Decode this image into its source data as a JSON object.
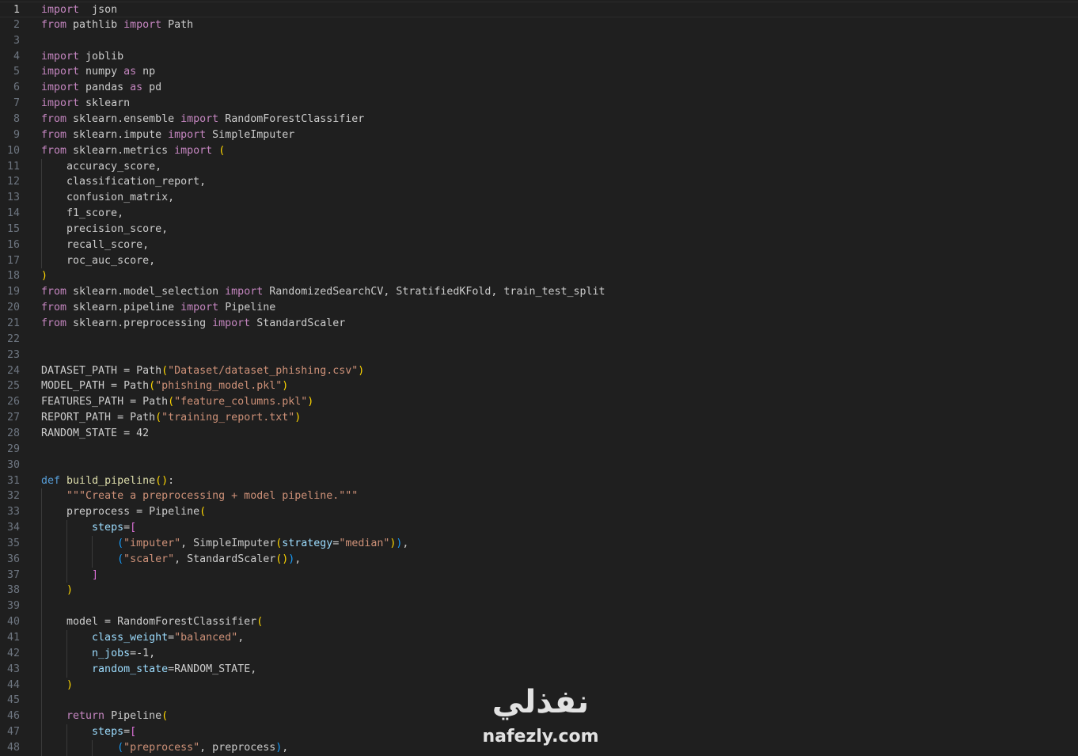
{
  "editor": {
    "language": "python",
    "current_line": 1,
    "lines": [
      {
        "n": "1",
        "indent": 0,
        "tokens": [
          [
            "kw",
            "import"
          ],
          [
            "",
            "  json"
          ]
        ]
      },
      {
        "n": "2",
        "indent": 0,
        "tokens": [
          [
            "kw",
            "from"
          ],
          [
            "",
            " pathlib "
          ],
          [
            "kw",
            "import"
          ],
          [
            "",
            " Path"
          ]
        ]
      },
      {
        "n": "3",
        "indent": 0,
        "tokens": []
      },
      {
        "n": "4",
        "indent": 0,
        "tokens": [
          [
            "kw",
            "import"
          ],
          [
            "",
            " joblib"
          ]
        ]
      },
      {
        "n": "5",
        "indent": 0,
        "tokens": [
          [
            "kw",
            "import"
          ],
          [
            "",
            " numpy "
          ],
          [
            "kw",
            "as"
          ],
          [
            "",
            " np"
          ]
        ]
      },
      {
        "n": "6",
        "indent": 0,
        "tokens": [
          [
            "kw",
            "import"
          ],
          [
            "",
            " pandas "
          ],
          [
            "kw",
            "as"
          ],
          [
            "",
            " pd"
          ]
        ]
      },
      {
        "n": "7",
        "indent": 0,
        "tokens": [
          [
            "kw",
            "import"
          ],
          [
            "",
            " sklearn"
          ]
        ]
      },
      {
        "n": "8",
        "indent": 0,
        "tokens": [
          [
            "kw",
            "from"
          ],
          [
            "",
            " sklearn.ensemble "
          ],
          [
            "kw",
            "import"
          ],
          [
            "",
            " RandomForestClassifier"
          ]
        ]
      },
      {
        "n": "9",
        "indent": 0,
        "tokens": [
          [
            "kw",
            "from"
          ],
          [
            "",
            " sklearn.impute "
          ],
          [
            "kw",
            "import"
          ],
          [
            "",
            " SimpleImputer"
          ]
        ]
      },
      {
        "n": "10",
        "indent": 0,
        "tokens": [
          [
            "kw",
            "from"
          ],
          [
            "",
            " sklearn.metrics "
          ],
          [
            "kw",
            "import"
          ],
          [
            "",
            " "
          ],
          [
            "par",
            "("
          ]
        ]
      },
      {
        "n": "11",
        "indent": 1,
        "tokens": [
          [
            "",
            "    accuracy_score,"
          ]
        ]
      },
      {
        "n": "12",
        "indent": 1,
        "tokens": [
          [
            "",
            "    classification_report,"
          ]
        ]
      },
      {
        "n": "13",
        "indent": 1,
        "tokens": [
          [
            "",
            "    confusion_matrix,"
          ]
        ]
      },
      {
        "n": "14",
        "indent": 1,
        "tokens": [
          [
            "",
            "    f1_score,"
          ]
        ]
      },
      {
        "n": "15",
        "indent": 1,
        "tokens": [
          [
            "",
            "    precision_score,"
          ]
        ]
      },
      {
        "n": "16",
        "indent": 1,
        "tokens": [
          [
            "",
            "    recall_score,"
          ]
        ]
      },
      {
        "n": "17",
        "indent": 1,
        "tokens": [
          [
            "",
            "    roc_auc_score,"
          ]
        ]
      },
      {
        "n": "18",
        "indent": 0,
        "tokens": [
          [
            "par",
            ")"
          ]
        ]
      },
      {
        "n": "19",
        "indent": 0,
        "tokens": [
          [
            "kw",
            "from"
          ],
          [
            "",
            " sklearn.model_selection "
          ],
          [
            "kw",
            "import"
          ],
          [
            "",
            " RandomizedSearchCV, StratifiedKFold, train_test_split"
          ]
        ]
      },
      {
        "n": "20",
        "indent": 0,
        "tokens": [
          [
            "kw",
            "from"
          ],
          [
            "",
            " sklearn.pipeline "
          ],
          [
            "kw",
            "import"
          ],
          [
            "",
            " Pipeline"
          ]
        ]
      },
      {
        "n": "21",
        "indent": 0,
        "tokens": [
          [
            "kw",
            "from"
          ],
          [
            "",
            " sklearn.preprocessing "
          ],
          [
            "kw",
            "import"
          ],
          [
            "",
            " StandardScaler"
          ]
        ]
      },
      {
        "n": "22",
        "indent": 0,
        "tokens": []
      },
      {
        "n": "23",
        "indent": 0,
        "tokens": []
      },
      {
        "n": "24",
        "indent": 0,
        "tokens": [
          [
            "",
            "DATASET_PATH = Path"
          ],
          [
            "par",
            "("
          ],
          [
            "str",
            "\"Dataset/dataset_phishing.csv\""
          ],
          [
            "par",
            ")"
          ]
        ]
      },
      {
        "n": "25",
        "indent": 0,
        "tokens": [
          [
            "",
            "MODEL_PATH = Path"
          ],
          [
            "par",
            "("
          ],
          [
            "str",
            "\"phishing_model.pkl\""
          ],
          [
            "par",
            ")"
          ]
        ]
      },
      {
        "n": "26",
        "indent": 0,
        "tokens": [
          [
            "",
            "FEATURES_PATH = Path"
          ],
          [
            "par",
            "("
          ],
          [
            "str",
            "\"feature_columns.pkl\""
          ],
          [
            "par",
            ")"
          ]
        ]
      },
      {
        "n": "27",
        "indent": 0,
        "tokens": [
          [
            "",
            "REPORT_PATH = Path"
          ],
          [
            "par",
            "("
          ],
          [
            "str",
            "\"training_report.txt\""
          ],
          [
            "par",
            ")"
          ]
        ]
      },
      {
        "n": "28",
        "indent": 0,
        "tokens": [
          [
            "",
            "RANDOM_STATE = "
          ],
          [
            "",
            "42"
          ]
        ]
      },
      {
        "n": "29",
        "indent": 0,
        "tokens": []
      },
      {
        "n": "30",
        "indent": 0,
        "tokens": []
      },
      {
        "n": "31",
        "indent": 0,
        "tokens": [
          [
            "def",
            "def"
          ],
          [
            "",
            " "
          ],
          [
            "fn",
            "build_pipeline"
          ],
          [
            "par",
            "()"
          ],
          [
            "",
            ":"
          ]
        ]
      },
      {
        "n": "32",
        "indent": 1,
        "tokens": [
          [
            "",
            "    "
          ],
          [
            "str",
            "\"\"\"Create a preprocessing + model pipeline.\"\"\""
          ]
        ]
      },
      {
        "n": "33",
        "indent": 1,
        "tokens": [
          [
            "",
            "    preprocess = Pipeline"
          ],
          [
            "par",
            "("
          ]
        ]
      },
      {
        "n": "34",
        "indent": 2,
        "tokens": [
          [
            "",
            "        "
          ],
          [
            "var",
            "steps"
          ],
          [
            "",
            "="
          ],
          [
            "br",
            "["
          ]
        ]
      },
      {
        "n": "35",
        "indent": 3,
        "tokens": [
          [
            "",
            "            "
          ],
          [
            "br3",
            "("
          ],
          [
            "str",
            "\"imputer\""
          ],
          [
            "",
            ", SimpleImputer"
          ],
          [
            "par",
            "("
          ],
          [
            "var",
            "strategy"
          ],
          [
            "",
            "="
          ],
          [
            "str",
            "\"median\""
          ],
          [
            "par",
            ")"
          ],
          [
            "br3",
            ")"
          ],
          [
            "",
            ","
          ]
        ]
      },
      {
        "n": "36",
        "indent": 3,
        "tokens": [
          [
            "",
            "            "
          ],
          [
            "br3",
            "("
          ],
          [
            "str",
            "\"scaler\""
          ],
          [
            "",
            ", StandardScaler"
          ],
          [
            "par",
            "()"
          ],
          [
            "br3",
            ")"
          ],
          [
            "",
            ","
          ]
        ]
      },
      {
        "n": "37",
        "indent": 2,
        "tokens": [
          [
            "",
            "        "
          ],
          [
            "br",
            "]"
          ]
        ]
      },
      {
        "n": "38",
        "indent": 1,
        "tokens": [
          [
            "",
            "    "
          ],
          [
            "par",
            ")"
          ]
        ]
      },
      {
        "n": "39",
        "indent": 1,
        "tokens": []
      },
      {
        "n": "40",
        "indent": 1,
        "tokens": [
          [
            "",
            "    model = RandomForestClassifier"
          ],
          [
            "par",
            "("
          ]
        ]
      },
      {
        "n": "41",
        "indent": 2,
        "tokens": [
          [
            "",
            "        "
          ],
          [
            "var",
            "class_weight"
          ],
          [
            "",
            "="
          ],
          [
            "str",
            "\"balanced\""
          ],
          [
            "",
            ","
          ]
        ]
      },
      {
        "n": "42",
        "indent": 2,
        "tokens": [
          [
            "",
            "        "
          ],
          [
            "var",
            "n_jobs"
          ],
          [
            "",
            "=-1,"
          ]
        ]
      },
      {
        "n": "43",
        "indent": 2,
        "tokens": [
          [
            "",
            "        "
          ],
          [
            "var",
            "random_state"
          ],
          [
            "",
            "=RANDOM_STATE,"
          ]
        ]
      },
      {
        "n": "44",
        "indent": 1,
        "tokens": [
          [
            "",
            "    "
          ],
          [
            "par",
            ")"
          ]
        ]
      },
      {
        "n": "45",
        "indent": 1,
        "tokens": []
      },
      {
        "n": "46",
        "indent": 1,
        "tokens": [
          [
            "",
            "    "
          ],
          [
            "kw",
            "return"
          ],
          [
            "",
            " Pipeline"
          ],
          [
            "par",
            "("
          ]
        ]
      },
      {
        "n": "47",
        "indent": 2,
        "tokens": [
          [
            "",
            "        "
          ],
          [
            "var",
            "steps"
          ],
          [
            "",
            "="
          ],
          [
            "br",
            "["
          ]
        ]
      },
      {
        "n": "48",
        "indent": 3,
        "tokens": [
          [
            "",
            "            "
          ],
          [
            "br3",
            "("
          ],
          [
            "str",
            "\"preprocess\""
          ],
          [
            "",
            ", preprocess"
          ],
          [
            "br3",
            ")"
          ],
          [
            "",
            ","
          ]
        ]
      }
    ]
  },
  "watermark": {
    "arabic_text": "نفذلي",
    "latin_text": "nafezly.com"
  },
  "colors": {
    "background": "#1f1f1f",
    "keyword": "#c586c0",
    "def_keyword": "#569cd6",
    "function": "#dcdcaa",
    "string": "#ce9178",
    "bracket": "#ffd700",
    "parameter": "#9cdcfe",
    "line_number": "#6e7681"
  }
}
